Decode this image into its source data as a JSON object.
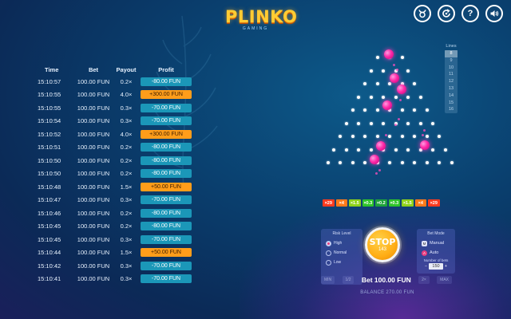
{
  "logo": {
    "title": "PLINKO",
    "subtitle": "GAMING"
  },
  "toolbar": {
    "buttons": [
      {
        "name": "rules-icon",
        "glyph": "♉"
      },
      {
        "name": "stats-icon",
        "glyph": "↻"
      },
      {
        "name": "help-icon",
        "glyph": "?"
      },
      {
        "name": "sound-icon",
        "glyph": "🔊"
      }
    ]
  },
  "history": {
    "headers": {
      "time": "Time",
      "bet": "Bet",
      "payout": "Payout",
      "profit": "Profit"
    },
    "rows": [
      {
        "time": "15:10:57",
        "bet": "100.00 FUN",
        "payout": "0.2×",
        "profit": "-80.00 FUN",
        "win": false
      },
      {
        "time": "15:10:55",
        "bet": "100.00 FUN",
        "payout": "4.0×",
        "profit": "+300.00 FUN",
        "win": true
      },
      {
        "time": "15:10:55",
        "bet": "100.00 FUN",
        "payout": "0.3×",
        "profit": "-70.00 FUN",
        "win": false
      },
      {
        "time": "15:10:54",
        "bet": "100.00 FUN",
        "payout": "0.3×",
        "profit": "-70.00 FUN",
        "win": false
      },
      {
        "time": "15:10:52",
        "bet": "100.00 FUN",
        "payout": "4.0×",
        "profit": "+300.00 FUN",
        "win": true
      },
      {
        "time": "15:10:51",
        "bet": "100.00 FUN",
        "payout": "0.2×",
        "profit": "-80.00 FUN",
        "win": false
      },
      {
        "time": "15:10:50",
        "bet": "100.00 FUN",
        "payout": "0.2×",
        "profit": "-80.00 FUN",
        "win": false
      },
      {
        "time": "15:10:50",
        "bet": "100.00 FUN",
        "payout": "0.2×",
        "profit": "-80.00 FUN",
        "win": false
      },
      {
        "time": "15:10:48",
        "bet": "100.00 FUN",
        "payout": "1.5×",
        "profit": "+50.00 FUN",
        "win": true
      },
      {
        "time": "15:10:47",
        "bet": "100.00 FUN",
        "payout": "0.3×",
        "profit": "-70.00 FUN",
        "win": false
      },
      {
        "time": "15:10:46",
        "bet": "100.00 FUN",
        "payout": "0.2×",
        "profit": "-80.00 FUN",
        "win": false
      },
      {
        "time": "15:10:45",
        "bet": "100.00 FUN",
        "payout": "0.2×",
        "profit": "-80.00 FUN",
        "win": false
      },
      {
        "time": "15:10:45",
        "bet": "100.00 FUN",
        "payout": "0.3×",
        "profit": "-70.00 FUN",
        "win": false
      },
      {
        "time": "15:10:44",
        "bet": "100.00 FUN",
        "payout": "1.5×",
        "profit": "+50.00 FUN",
        "win": true
      },
      {
        "time": "15:10:42",
        "bet": "100.00 FUN",
        "payout": "0.3×",
        "profit": "-70.00 FUN",
        "win": false
      },
      {
        "time": "15:10:41",
        "bet": "100.00 FUN",
        "payout": "0.3×",
        "profit": "-70.00 FUN",
        "win": false
      }
    ]
  },
  "lines": {
    "title": "Lines",
    "options": [
      "8",
      "9",
      "10",
      "11",
      "12",
      "13",
      "14",
      "15",
      "16"
    ],
    "selected": "8"
  },
  "multipliers": [
    {
      "label": "×29",
      "color": "#ff3b1f"
    },
    {
      "label": "×4",
      "color": "#ff7a1a"
    },
    {
      "label": "×1.5",
      "color": "#8fd11a"
    },
    {
      "label": "×0.3",
      "color": "#2fc42a"
    },
    {
      "label": "×0.2",
      "color": "#1ea33a"
    },
    {
      "label": "×0.3",
      "color": "#2fc42a"
    },
    {
      "label": "×1.5",
      "color": "#8fd11a"
    },
    {
      "label": "×4",
      "color": "#ff7a1a"
    },
    {
      "label": "×29",
      "color": "#ff3b1f"
    }
  ],
  "risk": {
    "title": "Risk Level",
    "options": [
      {
        "label": "High",
        "selected": true
      },
      {
        "label": "Normal",
        "selected": false
      },
      {
        "label": "Low",
        "selected": false
      }
    ]
  },
  "play": {
    "stop_label": "STOP",
    "count": "143"
  },
  "bet": {
    "label": "Bet 100.00 FUN",
    "min_label": "MIN",
    "half_label": "1/2",
    "double_label": "2×",
    "max_label": "MAX"
  },
  "balance": {
    "label": "BALANCE 270.00 FUN"
  },
  "mode": {
    "title": "Bet Mode",
    "manual_label": "Manual",
    "auto_label": "Auto",
    "number_label": "Number of bets",
    "number_value": "150",
    "selected": "Auto"
  },
  "colors": {
    "win": "#ff9d1a",
    "loss": "#1b97b8",
    "ball": "#ff2aa8",
    "accent": "#ffad15"
  }
}
